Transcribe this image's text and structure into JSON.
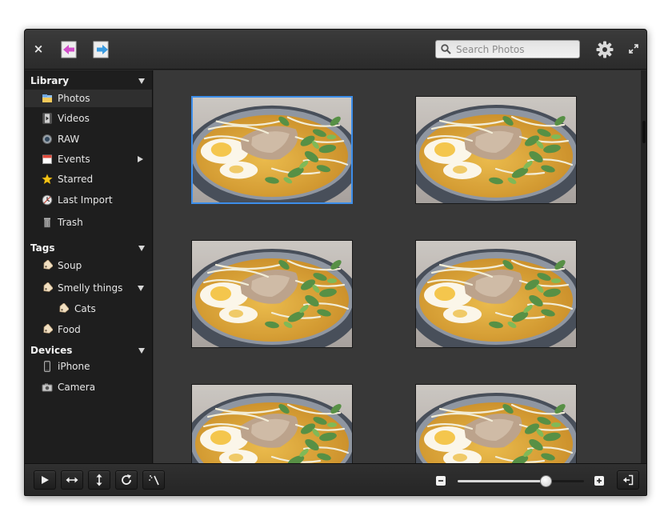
{
  "header": {
    "close_symbol": "×",
    "back_icon": "back-arrow-icon",
    "forward_icon": "forward-arrow-icon",
    "search_placeholder": "Search Photos",
    "settings_icon": "gear-icon",
    "fullscreen_icon": "fullscreen-icon"
  },
  "sidebar": {
    "library": {
      "title": "Library",
      "items": [
        {
          "label": "Photos",
          "icon": "photos-folder-icon",
          "selected": true
        },
        {
          "label": "Videos",
          "icon": "video-icon"
        },
        {
          "label": "RAW",
          "icon": "raw-icon"
        },
        {
          "label": "Events",
          "icon": "calendar-icon"
        },
        {
          "label": "Starred",
          "icon": "star-icon"
        },
        {
          "label": "Last Import",
          "icon": "last-import-icon"
        },
        {
          "label": "Trash",
          "icon": "trash-icon"
        }
      ]
    },
    "tags": {
      "title": "Tags",
      "items": [
        {
          "label": "Soup",
          "icon": "tag-icon"
        },
        {
          "label": "Smelly things",
          "icon": "tag-icon"
        },
        {
          "label": "Cats",
          "icon": "tag-icon"
        },
        {
          "label": "Food",
          "icon": "tag-icon"
        }
      ]
    },
    "devices": {
      "title": "Devices",
      "items": [
        {
          "label": "iPhone",
          "icon": "phone-icon"
        },
        {
          "label": "Camera",
          "icon": "camera-icon"
        }
      ]
    }
  },
  "photos": {
    "count_visible": 6,
    "selected_index": 0
  },
  "footer": {
    "zoom_level": 0.7
  },
  "colors": {
    "accent": "#3d8eea",
    "content_bg": "#383838",
    "sidebar_bg": "#1e1e1e"
  }
}
